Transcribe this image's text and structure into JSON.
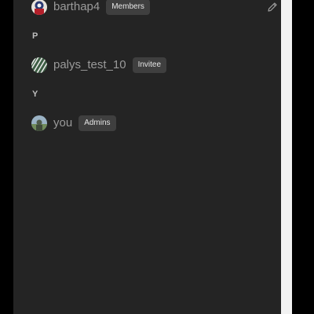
{
  "members": [
    {
      "username": "barthap4",
      "role": "Members",
      "avatar": "avatar-barthap4"
    },
    {
      "group": "P"
    },
    {
      "username": "palys_test_10",
      "role": "Invitee",
      "avatar": "avatar-palys"
    },
    {
      "group": "Y"
    },
    {
      "username": "you",
      "role": "Admins",
      "avatar": "avatar-you"
    }
  ],
  "icons": {
    "edit": "pencil-icon"
  },
  "colors": {
    "panel_bg": "#242424",
    "badge_bg": "#3f3f3f",
    "username": "#9a9a9a",
    "group_letter": "#bdbdbd"
  }
}
